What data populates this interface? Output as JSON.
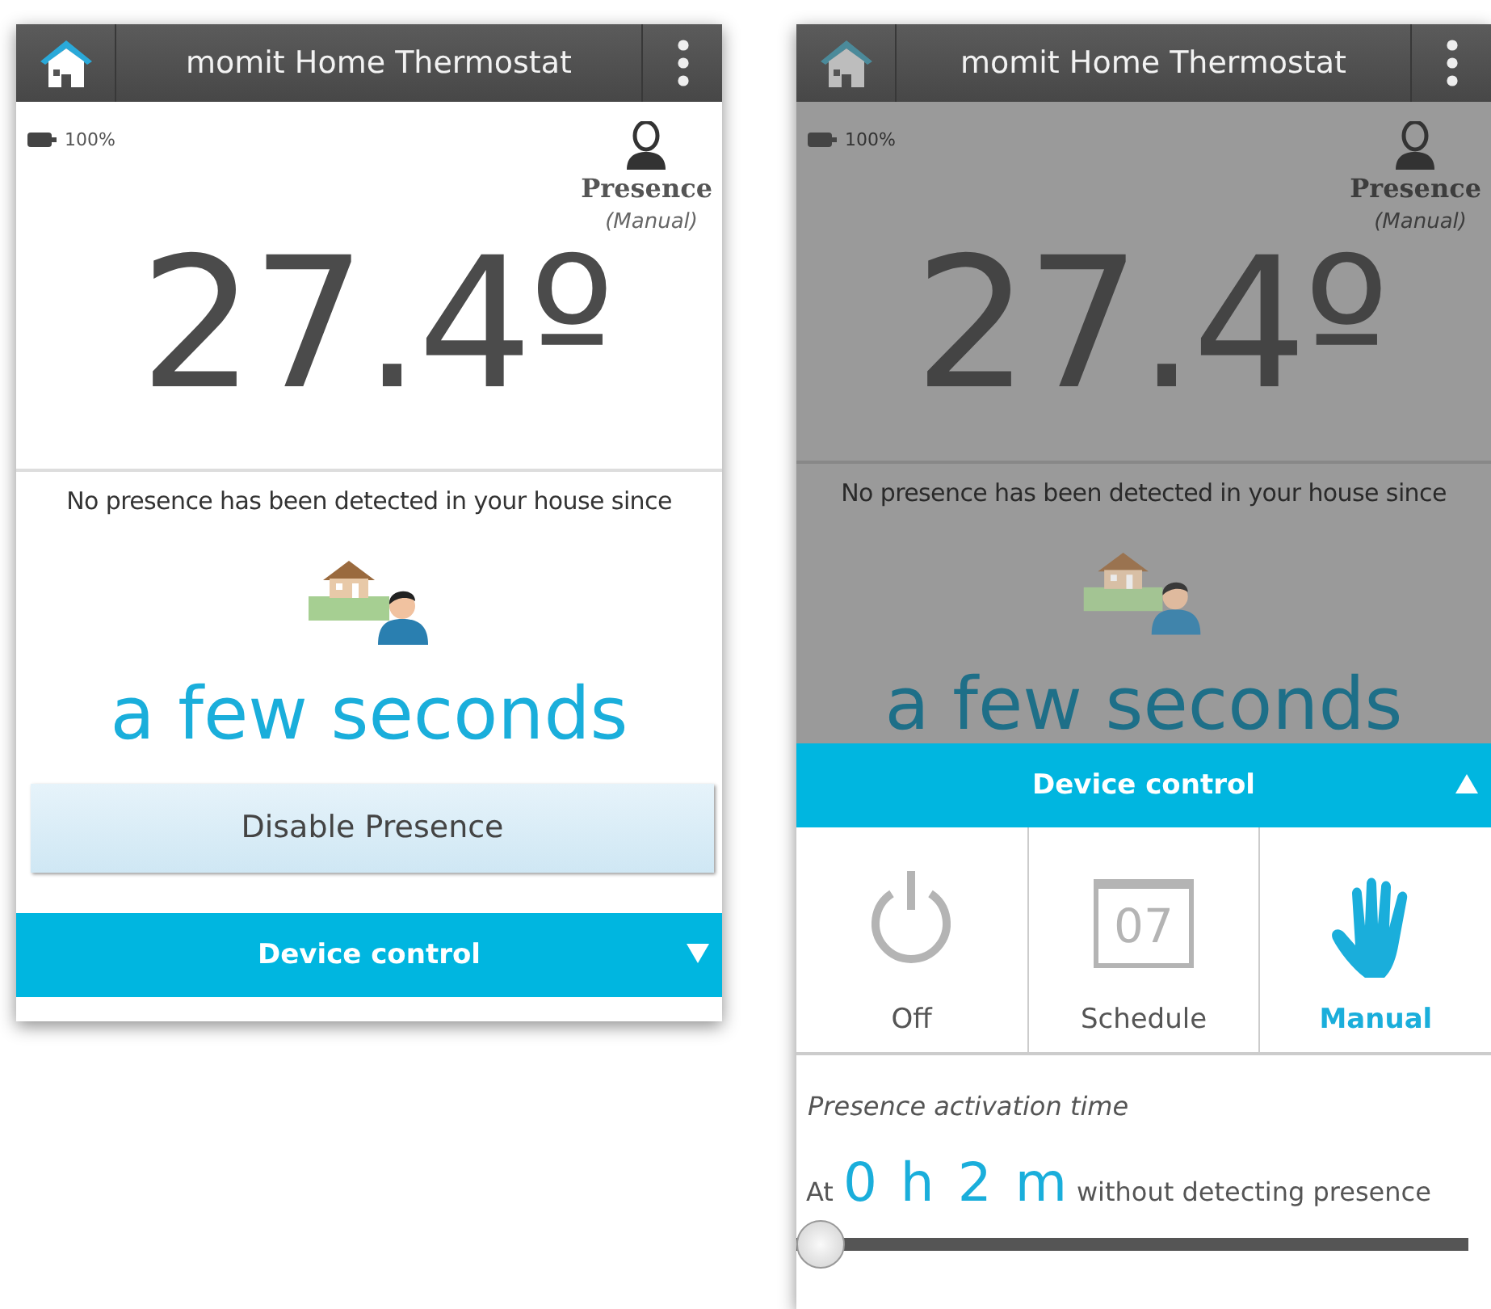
{
  "screens": [
    {
      "dimmed": false,
      "app_bar": {
        "title": "momit Home Thermostat"
      },
      "battery": "100%",
      "presence": {
        "label": "Presence",
        "mode": "(Manual)"
      },
      "temperature": "27.4º",
      "message": "No presence has been detected in your house since",
      "elapsed": "a few seconds",
      "disable_button": "Disable Presence",
      "device_control": {
        "title": "Device control",
        "expanded": false
      }
    },
    {
      "dimmed": true,
      "app_bar": {
        "title": "momit Home Thermostat"
      },
      "battery": "100%",
      "presence": {
        "label": "Presence",
        "mode": "(Manual)"
      },
      "temperature": "27.4º",
      "message": "No presence has been detected in your house since",
      "elapsed": "a few seconds",
      "device_control": {
        "title": "Device control",
        "expanded": true,
        "modes": [
          {
            "kind": "power",
            "label": "Off",
            "selected": false
          },
          {
            "kind": "calendar",
            "day": "07",
            "label": "Schedule",
            "selected": false
          },
          {
            "kind": "hand",
            "label": "Manual",
            "selected": true
          }
        ],
        "activation": {
          "title": "Presence activation time",
          "prefix": "At",
          "value": "0 h 2 m",
          "suffix": "without detecting presence",
          "level": 0
        }
      }
    }
  ]
}
